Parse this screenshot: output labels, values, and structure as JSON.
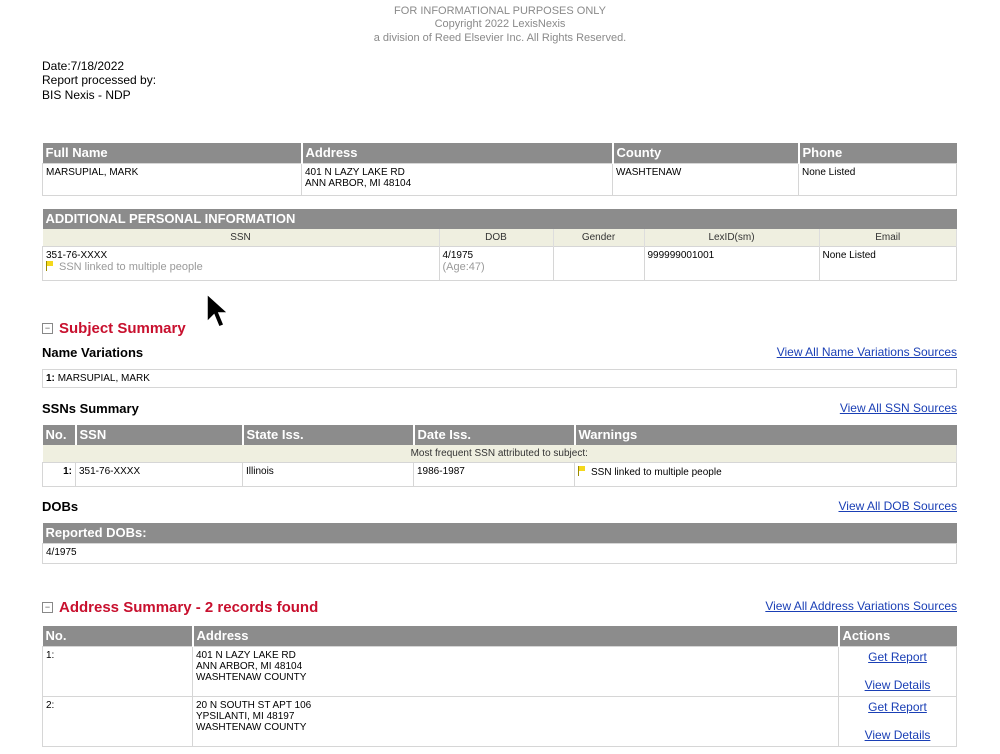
{
  "notice": {
    "line1": "FOR INFORMATIONAL PURPOSES ONLY",
    "line2": "Copyright 2022 LexisNexis",
    "line3": "a division of Reed Elsevier Inc. All Rights Reserved."
  },
  "report": {
    "date": "Date:7/18/2022",
    "processed_by_label": "Report processed by:",
    "processed_by": "BIS Nexis - NDP"
  },
  "person": {
    "headers": [
      "Full Name",
      "Address",
      "County",
      "Phone"
    ],
    "full_name": "MARSUPIAL, MARK",
    "address_line1": "401 N LAZY LAKE RD",
    "address_line2": "ANN ARBOR, MI 48104",
    "county": "WASHTENAW",
    "phone": "None Listed"
  },
  "additional": {
    "title": "ADDITIONAL PERSONAL INFORMATION",
    "headers": [
      "SSN",
      "DOB",
      "Gender",
      "LexID(sm)",
      "Email"
    ],
    "ssn": "351-76-XXXX",
    "ssn_warning": "SSN linked to multiple people",
    "dob": "4/1975",
    "age": "(Age:47)",
    "gender": "",
    "lexid": "999999001001",
    "email": "None Listed"
  },
  "subject_summary": {
    "title": "Subject Summary",
    "toggle": "−",
    "name_variations": {
      "label": "Name Variations",
      "link": "View All Name Variations Sources",
      "items": [
        {
          "num": "1:",
          "name": "MARSUPIAL, MARK"
        }
      ]
    },
    "ssns": {
      "label": "SSNs Summary",
      "link": "View All SSN Sources",
      "headers": [
        "No.",
        "SSN",
        "State Iss.",
        "Date Iss.",
        "Warnings"
      ],
      "note": "Most frequent SSN attributed to subject:",
      "rows": [
        {
          "num": "1:",
          "ssn": "351-76-XXXX",
          "state": "Illinois",
          "date": "1986-1987",
          "warning": "SSN linked to multiple people"
        }
      ]
    },
    "dobs": {
      "label": "DOBs",
      "link": "View All DOB Sources",
      "header": "Reported DOBs:",
      "value": "4/1975"
    }
  },
  "address_summary": {
    "title": "Address Summary - 2 records found",
    "toggle": "−",
    "link": "View All Address Variations Sources",
    "headers": [
      "No.",
      "Address",
      "Actions"
    ],
    "rows": [
      {
        "num": "1:",
        "line1": "401 N LAZY LAKE RD",
        "line2": "ANN ARBOR, MI 48104",
        "line3": "WASHTENAW COUNTY",
        "get_report": "Get Report",
        "view_details": "View Details"
      },
      {
        "num": "2:",
        "line1": "20 N SOUTH ST APT 106",
        "line2": "YPSILANTI, MI 48197",
        "line3": "WASHTENAW COUNTY",
        "get_report": "Get Report",
        "view_details": "View Details"
      }
    ]
  },
  "colors": {
    "header_gray": "#8c8c8c",
    "subheader_beige": "#efefe0",
    "section_red": "#c8102e",
    "link_blue": "#1a3fb5",
    "flag_yellow": "#f4d81c"
  }
}
